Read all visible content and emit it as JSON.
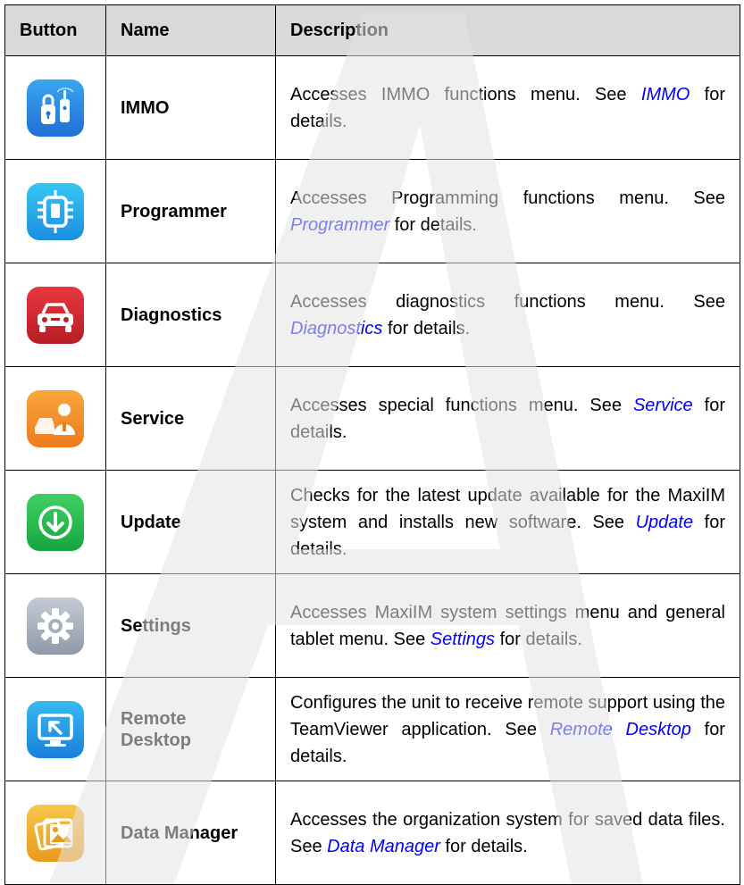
{
  "header": {
    "col_button": "Button",
    "col_name": "Name",
    "col_description": "Description"
  },
  "rows": [
    {
      "name": "IMMO",
      "desc_before": "Accesses IMMO functions menu. See ",
      "link": "IMMO",
      "desc_after": " for details.",
      "icon": "immo-key-fob-icon",
      "color_top": "#3aa6f0",
      "color_bottom": "#1f6fd6"
    },
    {
      "name": "Programmer",
      "desc_before": "Accesses Programming functions menu. See ",
      "link": "Programmer",
      "desc_after": " for details.",
      "icon": "programmer-chip-icon",
      "color_top": "#36c6f2",
      "color_bottom": "#1c8fe0"
    },
    {
      "name": "Diagnostics",
      "desc_before": "Accesses diagnostics functions menu. See ",
      "link": "Diagnostics",
      "desc_after": " for details.",
      "icon": "car-front-icon",
      "color_top": "#e8373e",
      "color_bottom": "#b81d24"
    },
    {
      "name": "Service",
      "desc_before": "Accesses special functions menu. See ",
      "link": "Service",
      "desc_after": " for details.",
      "icon": "service-technician-icon",
      "color_top": "#f8a63c",
      "color_bottom": "#ee7a1e"
    },
    {
      "name": "Update",
      "desc_before": "Checks for the latest update available for the MaxiIM system and installs new software. See ",
      "link": "Update",
      "desc_after": " for details.",
      "icon": "download-arrow-icon",
      "color_top": "#3fcf61",
      "color_bottom": "#16a640"
    },
    {
      "name": "Settings",
      "desc_before": "Accesses MaxiIM system settings menu and general tablet menu. See ",
      "link": "Settings",
      "desc_after": " for details.",
      "icon": "gear-icon",
      "color_top": "#c4cbd6",
      "color_bottom": "#8f99a8"
    },
    {
      "name": "Remote Desktop",
      "desc_before": "Configures the unit to receive remote support using the TeamViewer application. See ",
      "link": "Remote Desktop",
      "desc_after": " for details.",
      "icon": "remote-monitor-icon",
      "color_top": "#37b9f0",
      "color_bottom": "#1a7fdc"
    },
    {
      "name": "Data Manager",
      "desc_before": "Accesses the organization system for saved data files. See ",
      "link": "Data Manager",
      "desc_after": " for details.",
      "icon": "photo-gallery-icon",
      "color_top": "#f6c64a",
      "color_bottom": "#e89a1c"
    }
  ],
  "watermark": "Autel"
}
